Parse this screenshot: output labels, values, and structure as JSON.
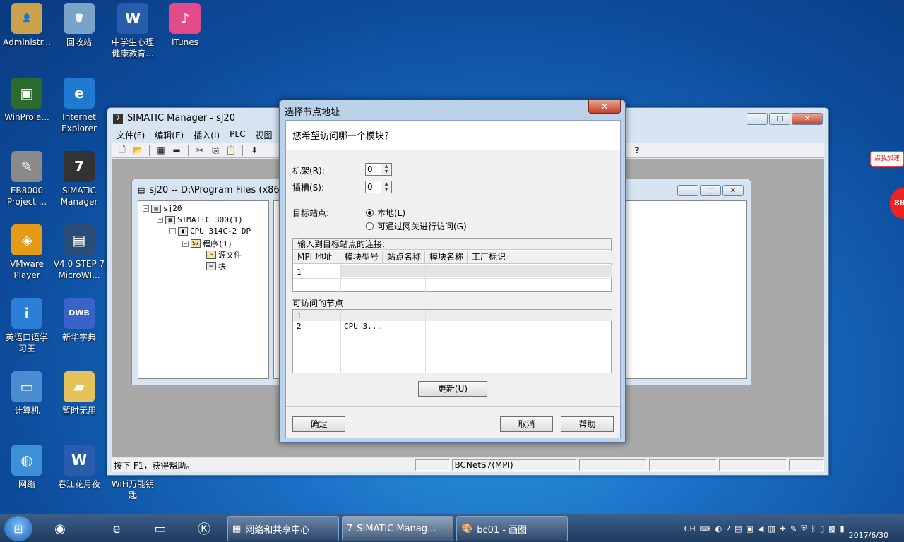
{
  "desktop": {
    "icons": [
      {
        "label": "Administr...",
        "glyph": "👤",
        "color": "#c9a24a"
      },
      {
        "label": "回收站",
        "glyph": "🗑",
        "color": "#7aa3c9"
      },
      {
        "label": "中学生心理\n健康教育...",
        "glyph": "W",
        "color": "#2a5cad"
      },
      {
        "label": "iTunes",
        "glyph": "♪",
        "color": "#e24a8a"
      },
      {
        "label": "WinProla...",
        "glyph": "▣",
        "color": "#2d6a2d"
      },
      {
        "label": "Internet\nExplorer",
        "glyph": "e",
        "color": "#1f7ad1"
      },
      {
        "label": "EB8000\nProject ...",
        "glyph": "✎",
        "color": "#8a8a8a"
      },
      {
        "label": "SIMATIC\nManager",
        "glyph": "7",
        "color": "#333333"
      },
      {
        "label": "VMware\nPlayer",
        "glyph": "◈",
        "color": "#e59b17"
      },
      {
        "label": "V4.0 STEP 7\nMicroWI...",
        "glyph": "▤",
        "color": "#2a4d7a"
      },
      {
        "label": "英语口语学\n习王",
        "glyph": "i",
        "color": "#2c7fd6"
      },
      {
        "label": "新华字典",
        "glyph": "DWB",
        "color": "#3a63c9"
      },
      {
        "label": "计算机",
        "glyph": "▭",
        "color": "#4a8ad0"
      },
      {
        "label": "暂时无用",
        "glyph": "▰",
        "color": "#e5c35a"
      },
      {
        "label": "网络",
        "glyph": "◍",
        "color": "#3d8fd8"
      },
      {
        "label": "春江花月夜",
        "glyph": "W",
        "color": "#2a5cad"
      },
      {
        "label": "WiFi万能钥\n匙",
        "glyph": "◔",
        "color": "#2fa6d9"
      }
    ]
  },
  "simatic": {
    "title": "SIMATIC Manager - sj20",
    "menu": [
      "文件(F)",
      "编辑(E)",
      "插入(I)",
      "PLC",
      "视图"
    ],
    "status_text": "按下 F1，获得帮助。",
    "status_network": "BCNetS7(MPI)",
    "project_window": {
      "title": "sj20 -- D:\\Program Files (x86)\\S",
      "tree": [
        "sj20",
        "SIMATIC 300(1)",
        "CPU 314C-2 DP",
        "程序(1)",
        "源文件",
        "块"
      ]
    }
  },
  "dialog": {
    "title": "选择节点地址",
    "question": "您希望访问哪一个模块？",
    "rack_label": "机架(R):",
    "rack_value": "0",
    "slot_label": "插槽(S):",
    "slot_value": "0",
    "target_label": "目标站点:",
    "radio_local": "本地(L)",
    "radio_gateway": "可通过网关进行访问(G)",
    "connection_caption": "输入到目标站点的连接:",
    "columns": [
      "MPI 地址",
      "模块型号",
      "站点名称",
      "模块名称",
      "工厂标识"
    ],
    "connection_rows": [
      [
        "1",
        "",
        "",
        "",
        ""
      ]
    ],
    "nodes_label": "可访问的节点",
    "nodes": [
      [
        "1",
        "",
        "",
        "",
        ""
      ],
      [
        "2",
        "CPU 3...",
        "",
        "",
        ""
      ]
    ],
    "update_button": "更新(U)",
    "ok_button": "确定",
    "cancel_button": "取消",
    "help_button": "帮助"
  },
  "taskbar": {
    "tasks": [
      "网络和共享中心",
      "SIMATIC Manag...",
      "bc01 - 画图"
    ],
    "tray_lang": "CH",
    "date": "2017/6/30"
  },
  "overlay": {
    "badge_text": "点我加速",
    "badge_number": "88"
  }
}
